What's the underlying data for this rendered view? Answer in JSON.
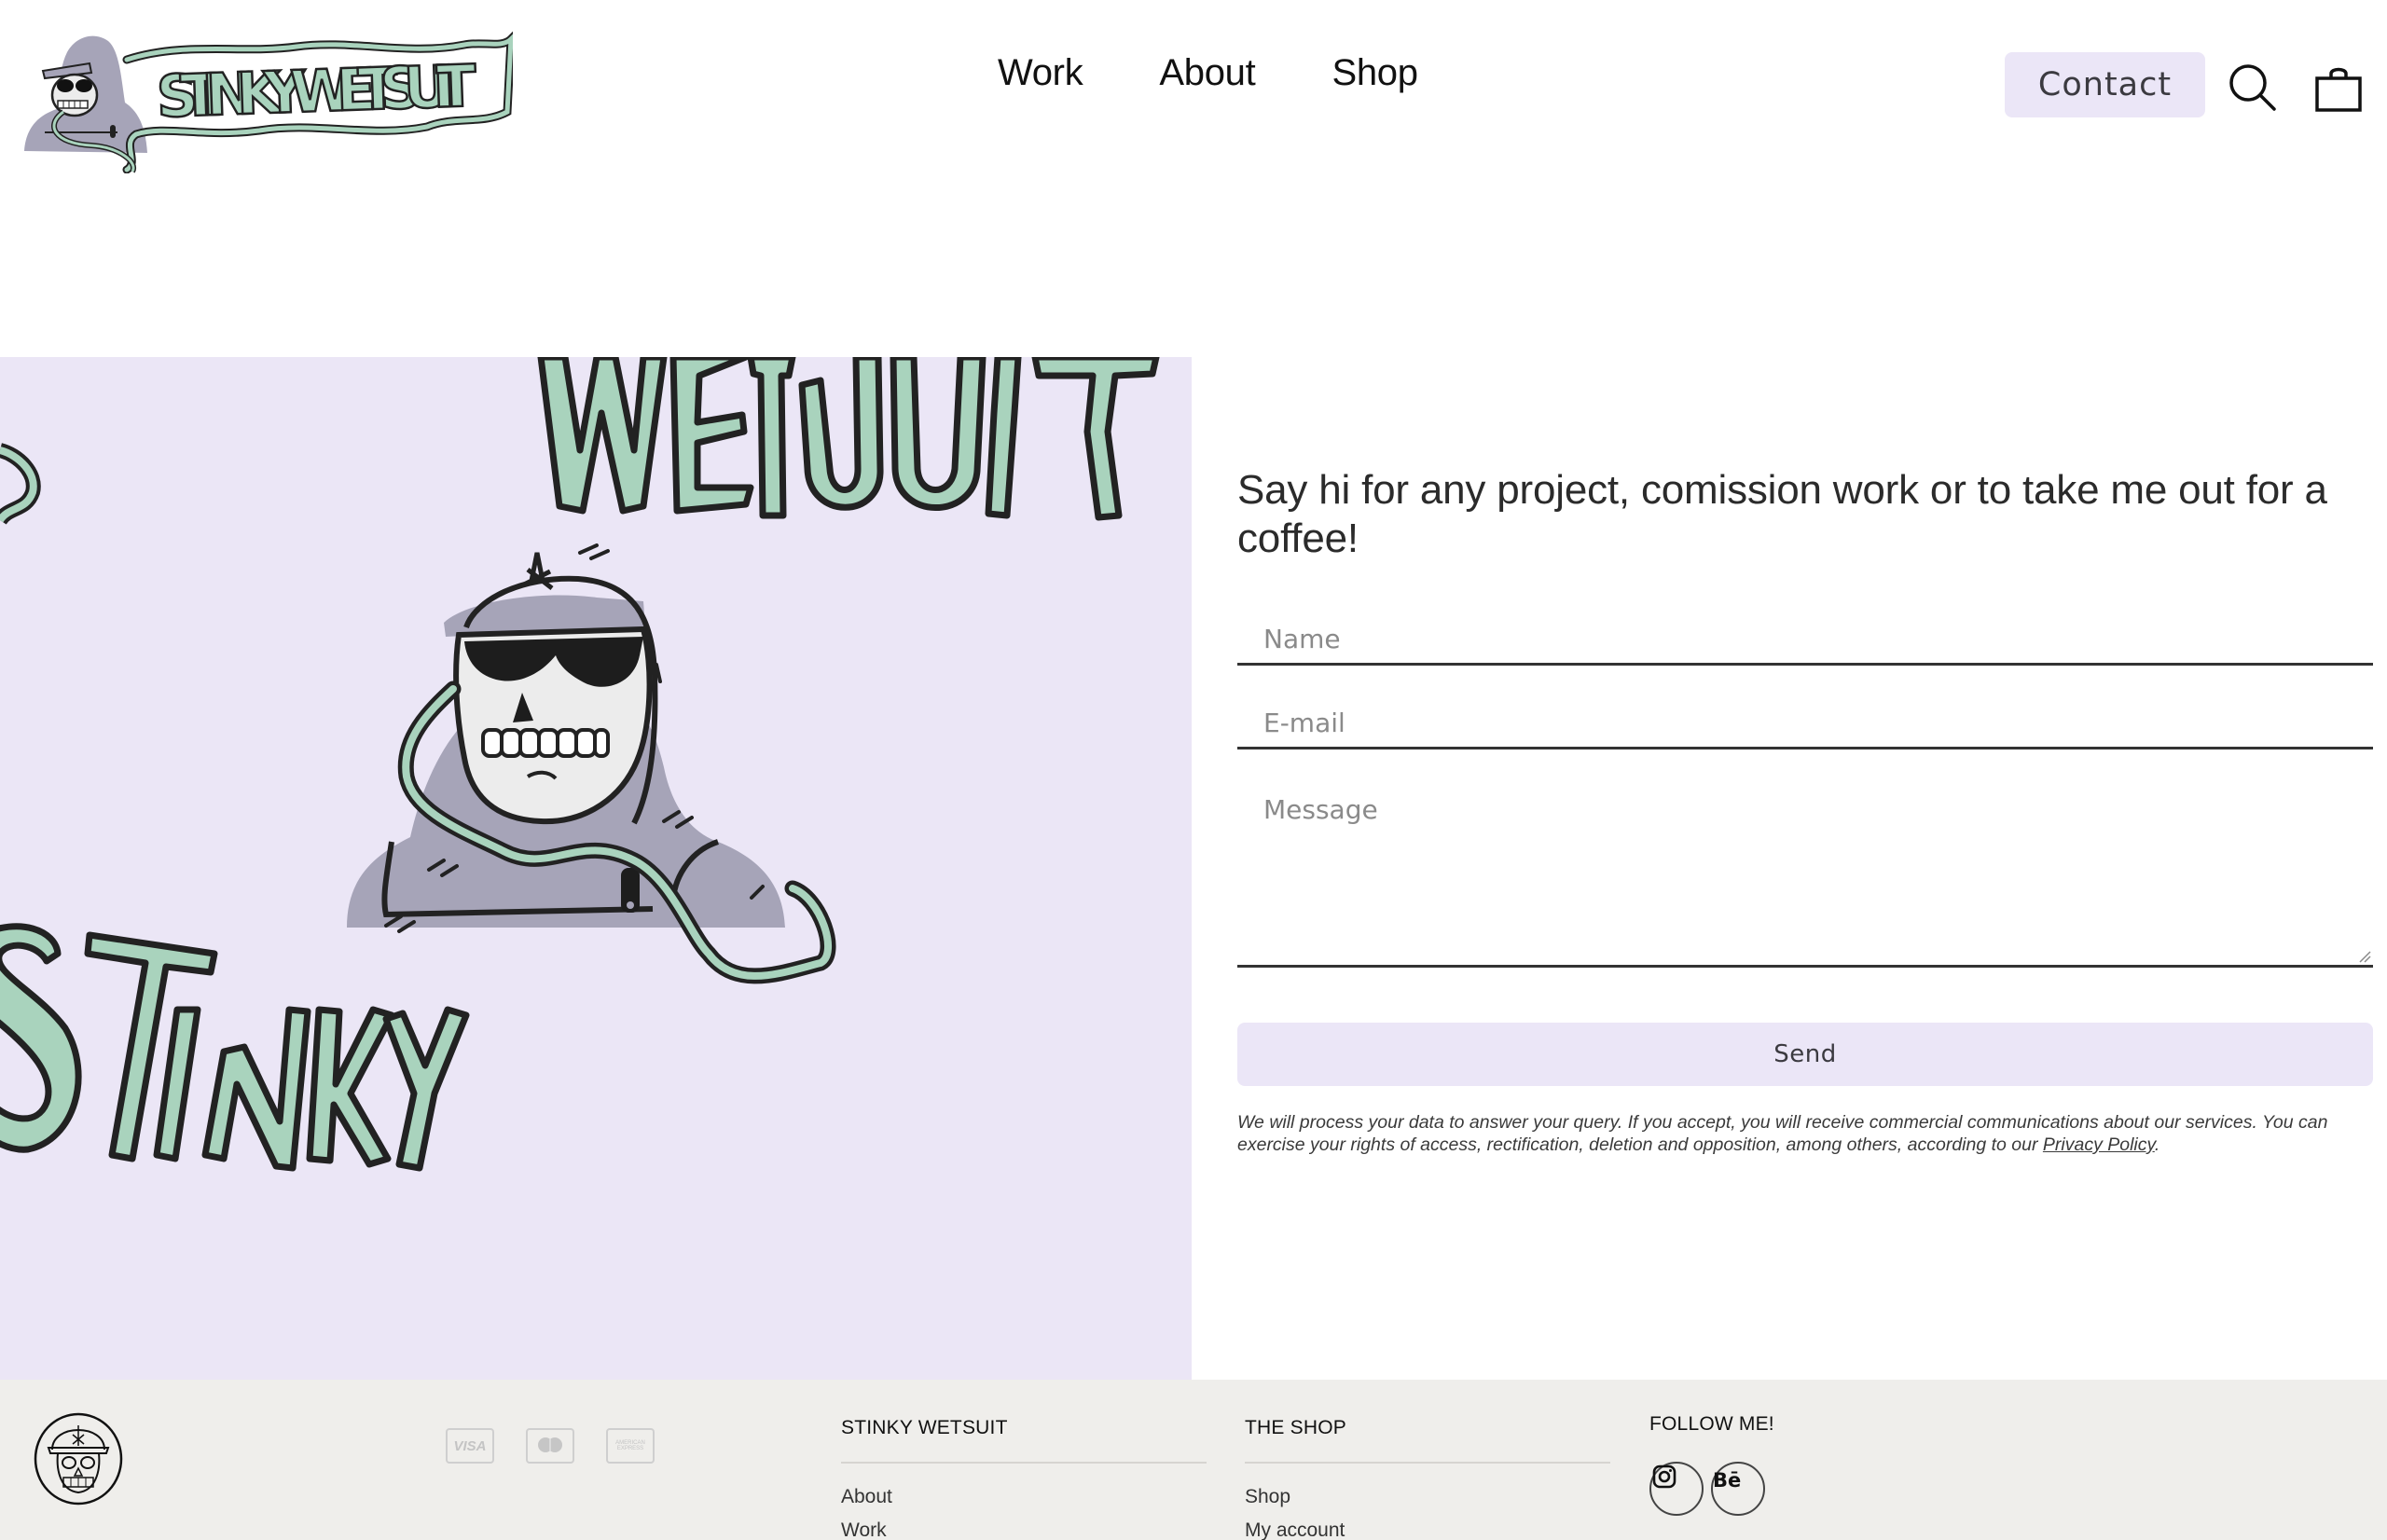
{
  "brand": {
    "name": "STINKY WETSUIT",
    "colors": {
      "accent_lavender": "#ebe6f7",
      "slime_green": "#a9d3bd",
      "hoodie_gray": "#a6a4b8",
      "footer_bg": "#efeeeb",
      "text_dark": "#1a1a1a"
    }
  },
  "header": {
    "logo_alt": "Stinky Wetsuit logo",
    "nav": [
      {
        "label": "Work"
      },
      {
        "label": "About"
      },
      {
        "label": "Shop"
      }
    ],
    "contact_label": "Contact",
    "search_icon": "search-icon",
    "cart_icon": "shopping-bag-icon"
  },
  "hero": {
    "illustration_words": [
      "WETSUIT",
      "STINKY"
    ],
    "illustration_alt": "Hooded skeleton with sunglasses and slime lettering"
  },
  "contact_form": {
    "title": "Say hi for any project, comission work or to take me out for a coffee!",
    "name_placeholder": "Name",
    "name_value": "",
    "email_placeholder": "E-mail",
    "email_value": "",
    "message_placeholder": "Message",
    "message_value": "",
    "send_label": "Send",
    "legal_text": "We will process your data to answer your query. If you accept, you will receive commercial communications about our services. You can exercise your rights of access, rectification, deletion and opposition, among others, according to our ",
    "privacy_link": "Privacy Policy",
    "legal_end": "."
  },
  "footer": {
    "payment_cards": [
      {
        "name": "visa",
        "label": "VISA"
      },
      {
        "name": "mastercard",
        "label": "mastercard"
      },
      {
        "name": "amex",
        "label": "AMERICAN EXPRESS"
      }
    ],
    "columns": [
      {
        "title": "STINKY WETSUIT",
        "links": [
          "About",
          "Work"
        ]
      },
      {
        "title": "THE SHOP",
        "links": [
          "Shop",
          "My account"
        ]
      }
    ],
    "follow": {
      "title": "FOLLOW ME!",
      "socials": [
        {
          "name": "instagram",
          "icon": "instagram-icon"
        },
        {
          "name": "behance",
          "label": "Bē",
          "icon": "behance-icon"
        }
      ]
    }
  }
}
